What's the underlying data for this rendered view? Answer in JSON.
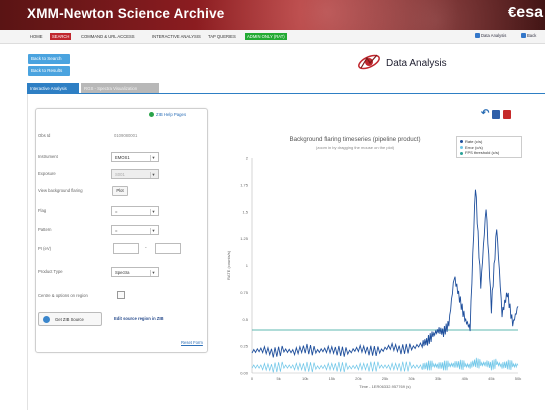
{
  "header": {
    "title": "XMM-Newton Science Archive",
    "logo": "esa"
  },
  "nav": {
    "items": [
      "HOME",
      "SEARCH",
      "COMMAND & URL ACCESS",
      "INTERACTIVE ANALYSIS",
      "TAP QUERIES",
      "ADMIN ONLY (RAT)"
    ],
    "right": [
      "Data Analysis",
      "Back"
    ]
  },
  "back_buttons": [
    "Back to Search",
    "Back to Results"
  ],
  "page": {
    "title": "Data Analysis"
  },
  "tabs": [
    "Interactive Analysis",
    "RGS - Spectra Visualization"
  ],
  "form": {
    "help_link": "ZIB Help Pages",
    "obs_id_label": "Obs Id",
    "obs_id_value": "0109080001",
    "instrument_label": "Instrument",
    "instrument_value": "EMOS1",
    "exposure_label": "Exposure",
    "exposure_value": "S001",
    "view_bg_label": "View background flaring",
    "plot_label": "Plot",
    "flag_label": "Flag",
    "flag_value": "=",
    "pattern_label": "Pattern",
    "pattern_value": "=",
    "pi_label": "PI (eV)",
    "pi_dash": "-",
    "product_type_label": "Product Type",
    "product_type_value": "Spectra",
    "centre_label": "Centre & options on region",
    "get_source_label": "Get ZIB Source",
    "edit_region_label": "Edit source region in ZIB",
    "reset_label": "Reset Form"
  },
  "chart_data": {
    "type": "line",
    "title": "Background flaring timeseries (pipeline product)",
    "subtitle": "(zoom in by dragging the mouse on the plot)",
    "xlabel": "Time - 1ER06332.957769 (s)",
    "ylabel": "RATE (counts/s)",
    "legend": [
      "Rate (c/s)",
      "Error (c/s)",
      "FPS threshold (c/s)"
    ],
    "legend_placement": "top-right",
    "colors": {
      "rate": "#1f4f9c",
      "error": "#6ec6e8",
      "threshold": "#2aa198"
    },
    "x_ticks": [
      "0",
      "5k",
      "10k",
      "15k",
      "20k",
      "25k",
      "30k",
      "35k",
      "40k",
      "45k",
      "50k"
    ],
    "y_ticks": [
      "0.00",
      "0.25",
      "0.5",
      "0.75",
      "1",
      "1.25",
      "1.5",
      "1.75",
      "2"
    ],
    "xlim": [
      0,
      50000
    ],
    "ylim": [
      0,
      2
    ],
    "threshold": 0.4,
    "x": [
      0,
      2000,
      4000,
      6000,
      8000,
      10000,
      12000,
      14000,
      16000,
      18000,
      20000,
      22000,
      24000,
      26000,
      28000,
      30000,
      32000,
      33000,
      34000,
      35000,
      36000,
      37000,
      38000,
      39000,
      40000,
      41000,
      42000,
      43000,
      44000,
      45000,
      46000,
      47000,
      48000,
      49000,
      50000
    ],
    "rate": [
      0.2,
      0.22,
      0.19,
      0.21,
      0.2,
      0.23,
      0.2,
      0.22,
      0.21,
      0.19,
      0.23,
      0.21,
      0.2,
      0.25,
      0.22,
      0.23,
      0.27,
      0.3,
      0.35,
      0.4,
      0.38,
      0.45,
      0.9,
      0.7,
      0.5,
      0.42,
      1.75,
      0.8,
      1.55,
      0.6,
      1.35,
      0.55,
      0.75,
      0.45,
      0.62
    ],
    "error": [
      0.06,
      0.06,
      0.05,
      0.06,
      0.06,
      0.06,
      0.05,
      0.06,
      0.06,
      0.05,
      0.06,
      0.06,
      0.06,
      0.06,
      0.06,
      0.06,
      0.06,
      0.07,
      0.07,
      0.07,
      0.07,
      0.07,
      0.08,
      0.08,
      0.07,
      0.07,
      0.1,
      0.08,
      0.09,
      0.07,
      0.09,
      0.07,
      0.08,
      0.07,
      0.07
    ]
  }
}
